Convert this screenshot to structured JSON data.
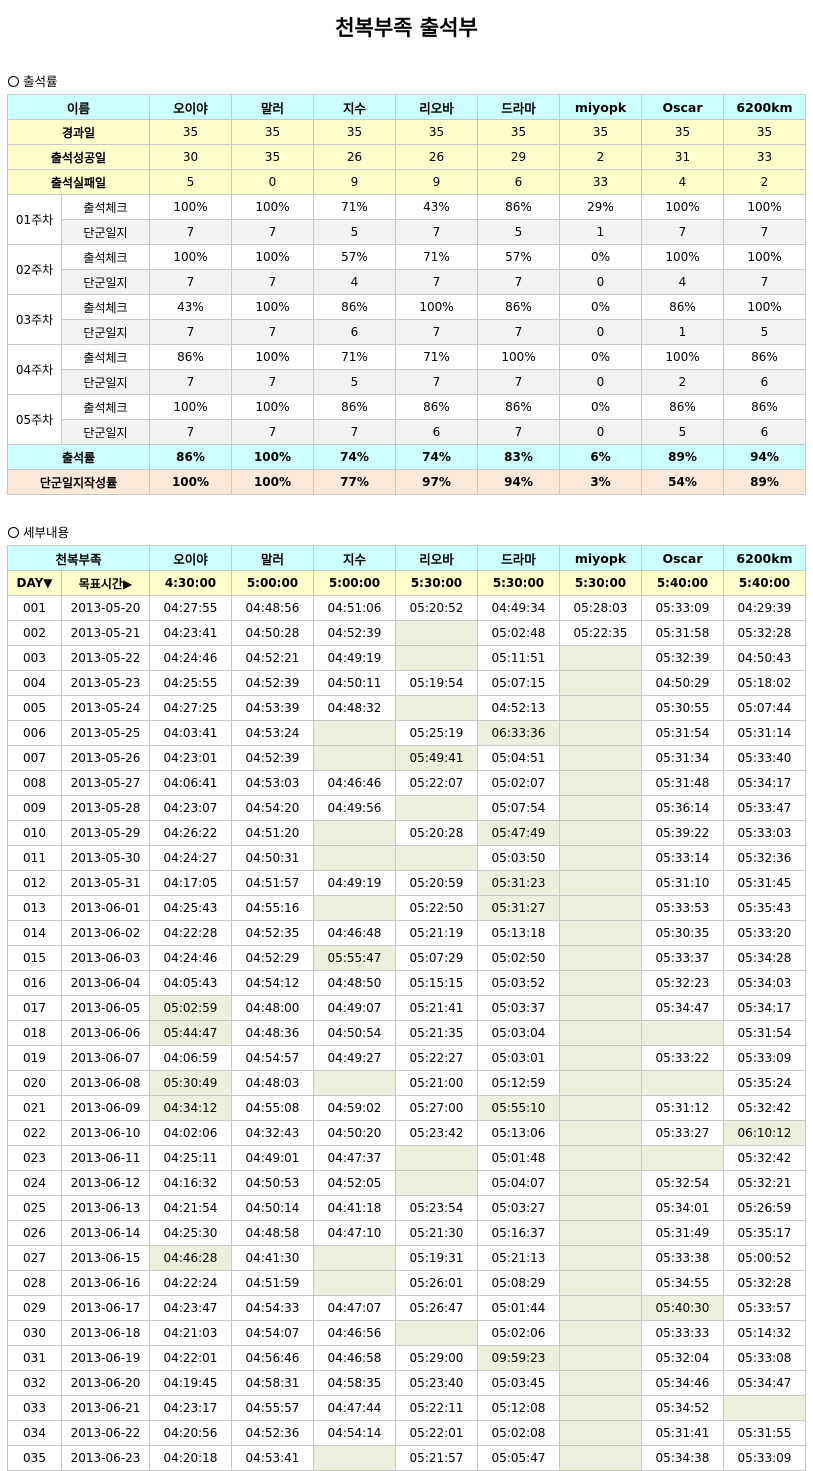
{
  "title": "천복부족 출석부",
  "summary": {
    "section_title": "출석률",
    "name_header": "이름",
    "members": [
      "오이야",
      "말러",
      "지수",
      "리오바",
      "드라마",
      "miyopk",
      "Oscar",
      "6200km"
    ],
    "stat_rows": [
      {
        "label": "경과일",
        "values": [
          "35",
          "35",
          "35",
          "35",
          "35",
          "35",
          "35",
          "35"
        ]
      },
      {
        "label": "출석성공일",
        "values": [
          "30",
          "35",
          "26",
          "26",
          "29",
          "2",
          "31",
          "33"
        ]
      },
      {
        "label": "출석실패일",
        "values": [
          "5",
          "0",
          "9",
          "9",
          "6",
          "33",
          "4",
          "2"
        ]
      }
    ],
    "weeks": [
      {
        "label": "01주차",
        "check_label": "출석체크",
        "diary_label": "단군일지",
        "check": [
          "100%",
          "100%",
          "71%",
          "43%",
          "86%",
          "29%",
          "100%",
          "100%"
        ],
        "diary": [
          "7",
          "7",
          "5",
          "7",
          "5",
          "1",
          "7",
          "7"
        ]
      },
      {
        "label": "02주차",
        "check_label": "출석체크",
        "diary_label": "단군일지",
        "check": [
          "100%",
          "100%",
          "57%",
          "71%",
          "57%",
          "0%",
          "100%",
          "100%"
        ],
        "diary": [
          "7",
          "7",
          "4",
          "7",
          "7",
          "0",
          "4",
          "7"
        ]
      },
      {
        "label": "03주차",
        "check_label": "출석체크",
        "diary_label": "단군일지",
        "check": [
          "43%",
          "100%",
          "86%",
          "100%",
          "86%",
          "0%",
          "86%",
          "100%"
        ],
        "diary": [
          "7",
          "7",
          "6",
          "7",
          "7",
          "0",
          "1",
          "5"
        ]
      },
      {
        "label": "04주차",
        "check_label": "출석체크",
        "diary_label": "단군일지",
        "check": [
          "86%",
          "100%",
          "71%",
          "71%",
          "100%",
          "0%",
          "100%",
          "86%"
        ],
        "diary": [
          "7",
          "7",
          "5",
          "7",
          "7",
          "0",
          "2",
          "6"
        ]
      },
      {
        "label": "05주차",
        "check_label": "출석체크",
        "diary_label": "단군일지",
        "check": [
          "100%",
          "100%",
          "86%",
          "86%",
          "86%",
          "0%",
          "86%",
          "86%"
        ],
        "diary": [
          "7",
          "7",
          "7",
          "6",
          "7",
          "0",
          "5",
          "6"
        ]
      }
    ],
    "attendance_rate": {
      "label": "출석률",
      "values": [
        "86%",
        "100%",
        "74%",
        "74%",
        "83%",
        "6%",
        "89%",
        "94%"
      ]
    },
    "diary_rate": {
      "label": "단군일지작성률",
      "values": [
        "100%",
        "100%",
        "77%",
        "97%",
        "94%",
        "3%",
        "54%",
        "89%"
      ]
    }
  },
  "detail": {
    "section_title": "세부내용",
    "corner_header": "천복부족",
    "members": [
      "오이야",
      "말러",
      "지수",
      "리오바",
      "드라마",
      "miyopk",
      "Oscar",
      "6200km"
    ],
    "day_header": "DAY▼",
    "target_header": "목표시간▶",
    "targets": [
      "4:30:00",
      "5:00:00",
      "5:00:00",
      "5:30:00",
      "5:30:00",
      "5:30:00",
      "5:40:00",
      "5:40:00"
    ],
    "rows": [
      {
        "day": "001",
        "date": "2013-05-20",
        "times": [
          "04:27:55",
          "04:48:56",
          "04:51:06",
          "05:20:52",
          "04:49:34",
          "05:28:03",
          "05:33:09",
          "04:29:39"
        ]
      },
      {
        "day": "002",
        "date": "2013-05-21",
        "times": [
          "04:23:41",
          "04:50:28",
          "04:52:39",
          "",
          "05:02:48",
          "05:22:35",
          "05:31:58",
          "05:32:28"
        ]
      },
      {
        "day": "003",
        "date": "2013-05-22",
        "times": [
          "04:24:46",
          "04:52:21",
          "04:49:19",
          "",
          "05:11:51",
          "",
          "05:32:39",
          "04:50:43"
        ]
      },
      {
        "day": "004",
        "date": "2013-05-23",
        "times": [
          "04:25:55",
          "04:52:39",
          "04:50:11",
          "05:19:54",
          "05:07:15",
          "",
          "04:50:29",
          "05:18:02"
        ]
      },
      {
        "day": "005",
        "date": "2013-05-24",
        "times": [
          "04:27:25",
          "04:53:39",
          "04:48:32",
          "",
          "04:52:13",
          "",
          "05:30:55",
          "05:07:44"
        ]
      },
      {
        "day": "006",
        "date": "2013-05-25",
        "times": [
          "04:03:41",
          "04:53:24",
          "",
          "05:25:19",
          "06:33:36",
          "",
          "05:31:54",
          "05:31:14"
        ]
      },
      {
        "day": "007",
        "date": "2013-05-26",
        "times": [
          "04:23:01",
          "04:52:39",
          "",
          "05:49:41",
          "05:04:51",
          "",
          "05:31:34",
          "05:33:40"
        ]
      },
      {
        "day": "008",
        "date": "2013-05-27",
        "times": [
          "04:06:41",
          "04:53:03",
          "04:46:46",
          "05:22:07",
          "05:02:07",
          "",
          "05:31:48",
          "05:34:17"
        ]
      },
      {
        "day": "009",
        "date": "2013-05-28",
        "times": [
          "04:23:07",
          "04:54:20",
          "04:49:56",
          "",
          "05:07:54",
          "",
          "05:36:14",
          "05:33:47"
        ]
      },
      {
        "day": "010",
        "date": "2013-05-29",
        "times": [
          "04:26:22",
          "04:51:20",
          "",
          "05:20:28",
          "05:47:49",
          "",
          "05:39:22",
          "05:33:03"
        ]
      },
      {
        "day": "011",
        "date": "2013-05-30",
        "times": [
          "04:24:27",
          "04:50:31",
          "",
          "",
          "05:03:50",
          "",
          "05:33:14",
          "05:32:36"
        ]
      },
      {
        "day": "012",
        "date": "2013-05-31",
        "times": [
          "04:17:05",
          "04:51:57",
          "04:49:19",
          "05:20:59",
          "05:31:23",
          "",
          "05:31:10",
          "05:31:45"
        ]
      },
      {
        "day": "013",
        "date": "2013-06-01",
        "times": [
          "04:25:43",
          "04:55:16",
          "",
          "05:22:50",
          "05:31:27",
          "",
          "05:33:53",
          "05:35:43"
        ]
      },
      {
        "day": "014",
        "date": "2013-06-02",
        "times": [
          "04:22:28",
          "04:52:35",
          "04:46:48",
          "05:21:19",
          "05:13:18",
          "",
          "05:30:35",
          "05:33:20"
        ]
      },
      {
        "day": "015",
        "date": "2013-06-03",
        "times": [
          "04:24:46",
          "04:52:29",
          "05:55:47",
          "05:07:29",
          "05:02:50",
          "",
          "05:33:37",
          "05:34:28"
        ]
      },
      {
        "day": "016",
        "date": "2013-06-04",
        "times": [
          "04:05:43",
          "04:54:12",
          "04:48:50",
          "05:15:15",
          "05:03:52",
          "",
          "05:32:23",
          "05:34:03"
        ]
      },
      {
        "day": "017",
        "date": "2013-06-05",
        "times": [
          "05:02:59",
          "04:48:00",
          "04:49:07",
          "05:21:41",
          "05:03:37",
          "",
          "05:34:47",
          "05:34:17"
        ]
      },
      {
        "day": "018",
        "date": "2013-06-06",
        "times": [
          "05:44:47",
          "04:48:36",
          "04:50:54",
          "05:21:35",
          "05:03:04",
          "",
          "",
          "05:31:54"
        ]
      },
      {
        "day": "019",
        "date": "2013-06-07",
        "times": [
          "04:06:59",
          "04:54:57",
          "04:49:27",
          "05:22:27",
          "05:03:01",
          "",
          "05:33:22",
          "05:33:09"
        ]
      },
      {
        "day": "020",
        "date": "2013-06-08",
        "times": [
          "05:30:49",
          "04:48:03",
          "",
          "05:21:00",
          "05:12:59",
          "",
          "",
          "05:35:24"
        ]
      },
      {
        "day": "021",
        "date": "2013-06-09",
        "times": [
          "04:34:12",
          "04:55:08",
          "04:59:02",
          "05:27:00",
          "05:55:10",
          "",
          "05:31:12",
          "05:32:42"
        ]
      },
      {
        "day": "022",
        "date": "2013-06-10",
        "times": [
          "04:02:06",
          "04:32:43",
          "04:50:20",
          "05:23:42",
          "05:13:06",
          "",
          "05:33:27",
          "06:10:12"
        ]
      },
      {
        "day": "023",
        "date": "2013-06-11",
        "times": [
          "04:25:11",
          "04:49:01",
          "04:47:37",
          "",
          "05:01:48",
          "",
          "",
          "05:32:42"
        ]
      },
      {
        "day": "024",
        "date": "2013-06-12",
        "times": [
          "04:16:32",
          "04:50:53",
          "04:52:05",
          "",
          "05:04:07",
          "",
          "05:32:54",
          "05:32:21"
        ]
      },
      {
        "day": "025",
        "date": "2013-06-13",
        "times": [
          "04:21:54",
          "04:50:14",
          "04:41:18",
          "05:23:54",
          "05:03:27",
          "",
          "05:34:01",
          "05:26:59"
        ]
      },
      {
        "day": "026",
        "date": "2013-06-14",
        "times": [
          "04:25:30",
          "04:48:58",
          "04:47:10",
          "05:21:30",
          "05:16:37",
          "",
          "05:31:49",
          "05:35:17"
        ]
      },
      {
        "day": "027",
        "date": "2013-06-15",
        "times": [
          "04:46:28",
          "04:41:30",
          "",
          "05:19:31",
          "05:21:13",
          "",
          "05:33:38",
          "05:00:52"
        ]
      },
      {
        "day": "028",
        "date": "2013-06-16",
        "times": [
          "04:22:24",
          "04:51:59",
          "",
          "05:26:01",
          "05:08:29",
          "",
          "05:34:55",
          "05:32:28"
        ]
      },
      {
        "day": "029",
        "date": "2013-06-17",
        "times": [
          "04:23:47",
          "04:54:33",
          "04:47:07",
          "05:26:47",
          "05:01:44",
          "",
          "05:40:30",
          "05:33:57"
        ]
      },
      {
        "day": "030",
        "date": "2013-06-18",
        "times": [
          "04:21:03",
          "04:54:07",
          "04:46:56",
          "",
          "05:02:06",
          "",
          "05:33:33",
          "05:14:32"
        ]
      },
      {
        "day": "031",
        "date": "2013-06-19",
        "times": [
          "04:22:01",
          "04:56:46",
          "04:46:58",
          "05:29:00",
          "09:59:23",
          "",
          "05:32:04",
          "05:33:08"
        ]
      },
      {
        "day": "032",
        "date": "2013-06-20",
        "times": [
          "04:19:45",
          "04:58:31",
          "04:58:35",
          "05:23:40",
          "05:03:45",
          "",
          "05:34:46",
          "05:34:47"
        ]
      },
      {
        "day": "033",
        "date": "2013-06-21",
        "times": [
          "04:23:17",
          "04:55:57",
          "04:47:44",
          "05:22:11",
          "05:12:08",
          "",
          "05:34:52",
          ""
        ]
      },
      {
        "day": "034",
        "date": "2013-06-22",
        "times": [
          "04:20:56",
          "04:52:36",
          "04:54:14",
          "05:22:01",
          "05:02:08",
          "",
          "05:31:41",
          "05:31:55"
        ]
      },
      {
        "day": "035",
        "date": "2013-06-23",
        "times": [
          "04:20:18",
          "04:53:41",
          "",
          "05:21:57",
          "05:05:47",
          "",
          "05:34:38",
          "05:33:09"
        ]
      }
    ]
  }
}
